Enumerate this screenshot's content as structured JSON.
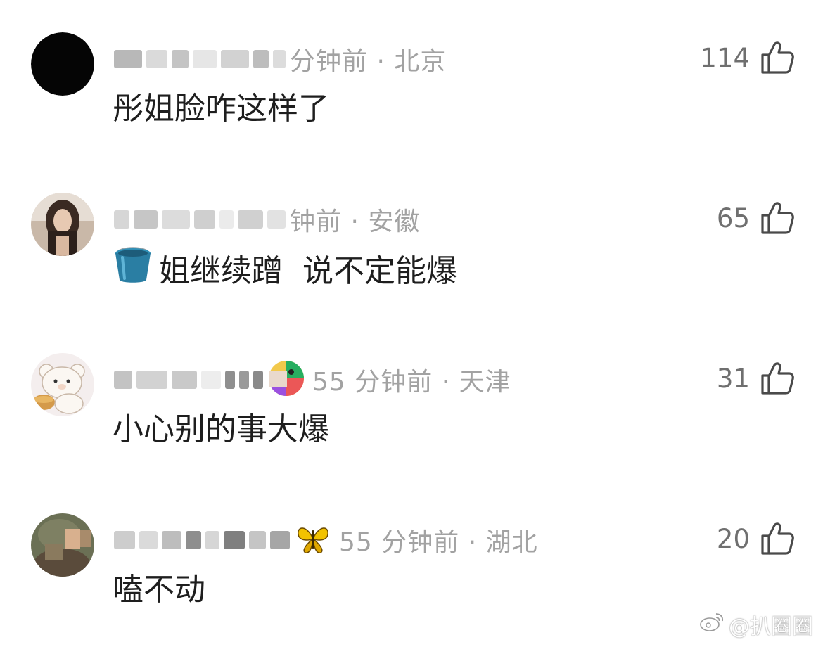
{
  "comments": [
    {
      "time_location": "分钟前 · 北京",
      "text": "彤姐脸咋这样了",
      "likes": "114",
      "avatar_icon": "black-avatar",
      "like_icon": "thumbs-up-icon"
    },
    {
      "time_location": "钟前 · 安徽",
      "text": "姐继续蹭  说不定能爆",
      "emoji": "bucket-icon",
      "likes": "65",
      "avatar_icon": "girl-photo-avatar",
      "like_icon": "thumbs-up-icon"
    },
    {
      "time_location": "55 分钟前 · 天津",
      "text": "小心别的事大爆",
      "likes": "31",
      "avatar_icon": "bear-avatar",
      "badge_icon": "colorful-badge-icon",
      "like_icon": "thumbs-up-icon"
    },
    {
      "time_location": "55 分钟前 · 湖北",
      "text": "嗑不动",
      "likes": "20",
      "avatar_icon": "child-photo-avatar",
      "badge_icon": "butterfly-icon",
      "like_icon": "thumbs-up-icon"
    }
  ],
  "watermark": {
    "text": "@扒圈圈",
    "icon": "weibo-icon"
  },
  "colors": {
    "meta_gray": "#a2a2a2",
    "text_dark": "#1e1e1e",
    "like_gray": "#6f6f6f"
  }
}
